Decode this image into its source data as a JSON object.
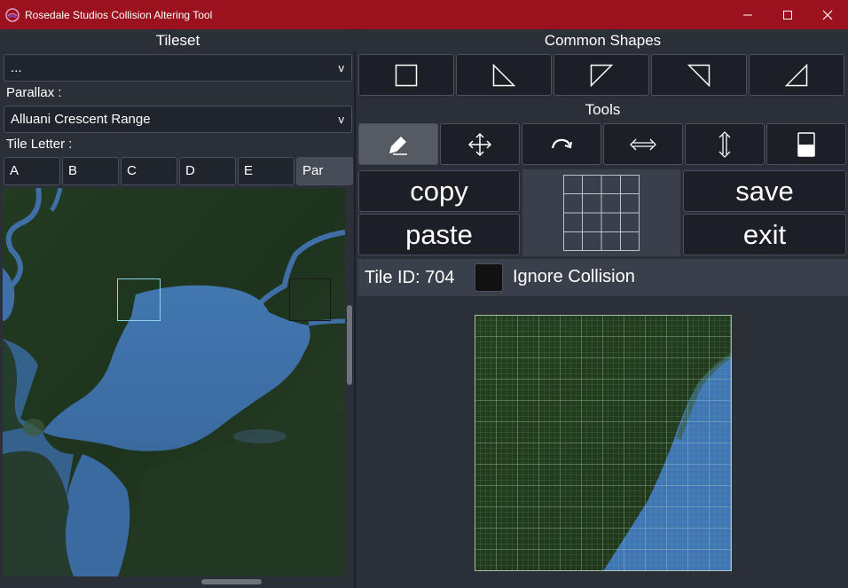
{
  "window": {
    "title": "Rosedale Studios Collision Altering Tool"
  },
  "tileset": {
    "header": "Tileset",
    "selected": "...",
    "chevron": "v"
  },
  "parallax": {
    "label": "Parallax :",
    "selected": "Alluani Crescent Range",
    "chevron": "v"
  },
  "tile_letter": {
    "label": "Tile Letter :",
    "buttons": [
      "A",
      "B",
      "C",
      "D",
      "E",
      "Par"
    ],
    "active": "Par"
  },
  "common_shapes": {
    "header": "Common Shapes",
    "shapes": [
      "square-shape-icon",
      "triangle-bottom-left-icon",
      "triangle-top-left-icon",
      "triangle-top-right-icon",
      "triangle-bottom-right-icon"
    ]
  },
  "tools": {
    "header": "Tools",
    "items": [
      "pencil-icon",
      "move-icon",
      "redo-icon",
      "horizontal-resize-icon",
      "vertical-resize-icon",
      "half-fill-icon"
    ],
    "active": "pencil-icon"
  },
  "actions": {
    "copy": "copy",
    "paste": "paste",
    "save": "save",
    "exit": "exit"
  },
  "tile_info": {
    "tile_id": "Tile ID: 704",
    "ignore_collision_label": "Ignore Collision",
    "ignore_collision_checked": false
  },
  "colors": {
    "titlebar": "#9b111e",
    "background": "#2b2f38",
    "button": "#1c1f26",
    "active_button": "#555a63",
    "water": "#3d6fa8",
    "land": "#1f3a1f"
  }
}
